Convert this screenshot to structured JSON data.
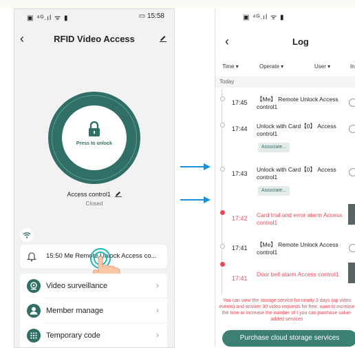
{
  "top_strip": {
    "text": "",
    "tint": "#d8d8a0"
  },
  "phone1": {
    "status": {
      "left": "▣ ⁴ᴳ.ıl ᯤ ▮",
      "battery": "▭",
      "time": "15:58"
    },
    "title": "RFID Video Access",
    "lock_label": "Press to unlock",
    "access_control_name": "Access control1",
    "access_status": "Closed",
    "latest_log": "15:50 Me  Remote Unlock Access co...",
    "menu": [
      {
        "label": "Video surveillance",
        "icon": "camera-icon"
      },
      {
        "label": "Member manage",
        "icon": "person-icon"
      },
      {
        "label": "Temporary code",
        "icon": "keypad-icon"
      }
    ],
    "accent": "#2f6f66"
  },
  "phone2": {
    "status": {
      "left": "▣ ⁴ᴳ.ıl ᯤ ▮"
    },
    "title": "Log",
    "filters": [
      "Time ▾",
      "Operate ▾",
      "User ▾",
      "In"
    ],
    "section": "Today",
    "entries": [
      {
        "time": "17:45",
        "text": "【Me】 Remote Unlock Access control1"
      },
      {
        "time": "17:44",
        "text": "Unlock with Card【0】 Access control1",
        "assoc": "Associate..."
      },
      {
        "time": "17:43",
        "text": "Unlock with Card【0】 Access control1",
        "assoc": "Associate..."
      },
      {
        "time": "17:42",
        "text": "Card trial and error alarm Access control1"
      },
      {
        "time": "17:41",
        "text": "【Me】 Remote Unlock Access control1"
      },
      {
        "time": "17:41",
        "text": "Door bell alarm Access control1"
      }
    ],
    "notice": "You can view the storage service for nearly 3 days (up video events) and answer 30 video requests for free. want to increase the time or increase the number of t you can purchase value-added services",
    "cloud_button": "Purchase cloud storage services",
    "alarm_color": "#e54b57"
  }
}
